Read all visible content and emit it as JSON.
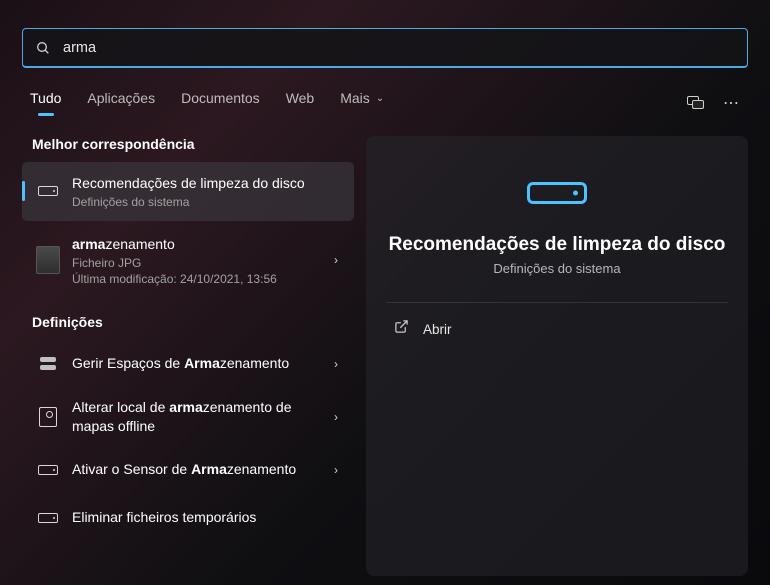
{
  "search": {
    "value": "arma"
  },
  "tabs": {
    "all": "Tudo",
    "apps": "Aplicações",
    "docs": "Documentos",
    "web": "Web",
    "more": "Mais"
  },
  "sections": {
    "best_match": "Melhor correspondência",
    "settings": "Definições"
  },
  "best": {
    "title": "Recomendações de limpeza do disco",
    "sub": "Definições do sistema"
  },
  "file_result": {
    "title_prefix": "arma",
    "title_rest": "zenamento",
    "line2": "Ficheiro JPG",
    "line3": "Última modificação: 24/10/2021, 13:56"
  },
  "settings_results": [
    {
      "pre": "Gerir Espaços de ",
      "bold": "Arma",
      "post": "zenamento"
    },
    {
      "pre": "Alterar local de ",
      "bold": "arma",
      "post": "zenamento de mapas offline"
    },
    {
      "pre": "Ativar o Sensor de ",
      "bold": "Arma",
      "post": "zenamento"
    },
    {
      "pre": "Eliminar ficheiros temporários",
      "bold": "",
      "post": ""
    }
  ],
  "preview": {
    "title": "Recomendações de limpeza do disco",
    "sub": "Definições do sistema",
    "open": "Abrir"
  }
}
